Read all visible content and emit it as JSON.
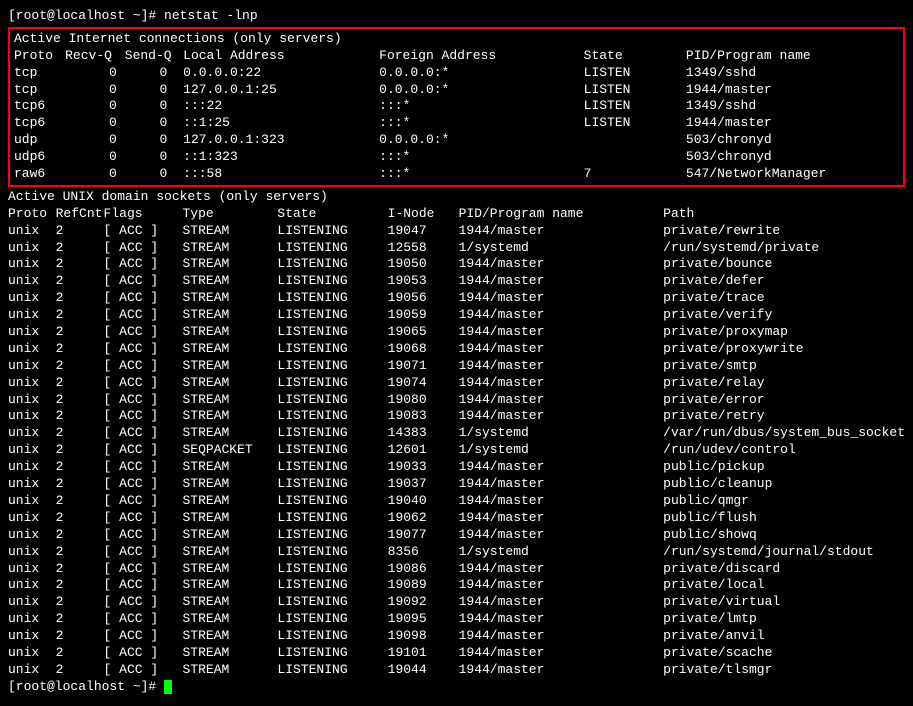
{
  "prompt1": "[root@localhost ~]# netstat -lnp",
  "prompt2": "[root@localhost ~]# ",
  "section1": {
    "title": "Active Internet connections (only servers)",
    "headers": {
      "proto": "Proto",
      "recvq": "Recv-Q",
      "sendq": "Send-Q",
      "local": "Local Address",
      "foreign": "Foreign Address",
      "state": "State",
      "pid": "PID/Program name"
    },
    "rows": [
      {
        "proto": "tcp",
        "recvq": "0",
        "sendq": "0",
        "local": "0.0.0.0:22",
        "foreign": "0.0.0.0:*",
        "state": "LISTEN",
        "pid": "1349/sshd"
      },
      {
        "proto": "tcp",
        "recvq": "0",
        "sendq": "0",
        "local": "127.0.0.1:25",
        "foreign": "0.0.0.0:*",
        "state": "LISTEN",
        "pid": "1944/master"
      },
      {
        "proto": "tcp6",
        "recvq": "0",
        "sendq": "0",
        "local": ":::22",
        "foreign": ":::*",
        "state": "LISTEN",
        "pid": "1349/sshd"
      },
      {
        "proto": "tcp6",
        "recvq": "0",
        "sendq": "0",
        "local": "::1:25",
        "foreign": ":::*",
        "state": "LISTEN",
        "pid": "1944/master"
      },
      {
        "proto": "udp",
        "recvq": "0",
        "sendq": "0",
        "local": "127.0.0.1:323",
        "foreign": "0.0.0.0:*",
        "state": "",
        "pid": "503/chronyd"
      },
      {
        "proto": "udp6",
        "recvq": "0",
        "sendq": "0",
        "local": "::1:323",
        "foreign": ":::*",
        "state": "",
        "pid": "503/chronyd"
      },
      {
        "proto": "raw6",
        "recvq": "0",
        "sendq": "0",
        "local": ":::58",
        "foreign": ":::*",
        "state": "7",
        "pid": "547/NetworkManager"
      }
    ]
  },
  "section2": {
    "title": "Active UNIX domain sockets (only servers)",
    "headers": {
      "proto": "Proto",
      "refcnt": "RefCnt",
      "flags": "Flags",
      "type": "Type",
      "state": "State",
      "inode": "I-Node",
      "pid": "PID/Program name",
      "path": "Path"
    },
    "rows": [
      {
        "proto": "unix",
        "refcnt": "2",
        "flags": "[ ACC ]",
        "type": "STREAM",
        "state": "LISTENING",
        "inode": "19047",
        "pid": "1944/master",
        "path": "private/rewrite"
      },
      {
        "proto": "unix",
        "refcnt": "2",
        "flags": "[ ACC ]",
        "type": "STREAM",
        "state": "LISTENING",
        "inode": "12558",
        "pid": "1/systemd",
        "path": "/run/systemd/private"
      },
      {
        "proto": "unix",
        "refcnt": "2",
        "flags": "[ ACC ]",
        "type": "STREAM",
        "state": "LISTENING",
        "inode": "19050",
        "pid": "1944/master",
        "path": "private/bounce"
      },
      {
        "proto": "unix",
        "refcnt": "2",
        "flags": "[ ACC ]",
        "type": "STREAM",
        "state": "LISTENING",
        "inode": "19053",
        "pid": "1944/master",
        "path": "private/defer"
      },
      {
        "proto": "unix",
        "refcnt": "2",
        "flags": "[ ACC ]",
        "type": "STREAM",
        "state": "LISTENING",
        "inode": "19056",
        "pid": "1944/master",
        "path": "private/trace"
      },
      {
        "proto": "unix",
        "refcnt": "2",
        "flags": "[ ACC ]",
        "type": "STREAM",
        "state": "LISTENING",
        "inode": "19059",
        "pid": "1944/master",
        "path": "private/verify"
      },
      {
        "proto": "unix",
        "refcnt": "2",
        "flags": "[ ACC ]",
        "type": "STREAM",
        "state": "LISTENING",
        "inode": "19065",
        "pid": "1944/master",
        "path": "private/proxymap"
      },
      {
        "proto": "unix",
        "refcnt": "2",
        "flags": "[ ACC ]",
        "type": "STREAM",
        "state": "LISTENING",
        "inode": "19068",
        "pid": "1944/master",
        "path": "private/proxywrite"
      },
      {
        "proto": "unix",
        "refcnt": "2",
        "flags": "[ ACC ]",
        "type": "STREAM",
        "state": "LISTENING",
        "inode": "19071",
        "pid": "1944/master",
        "path": "private/smtp"
      },
      {
        "proto": "unix",
        "refcnt": "2",
        "flags": "[ ACC ]",
        "type": "STREAM",
        "state": "LISTENING",
        "inode": "19074",
        "pid": "1944/master",
        "path": "private/relay"
      },
      {
        "proto": "unix",
        "refcnt": "2",
        "flags": "[ ACC ]",
        "type": "STREAM",
        "state": "LISTENING",
        "inode": "19080",
        "pid": "1944/master",
        "path": "private/error"
      },
      {
        "proto": "unix",
        "refcnt": "2",
        "flags": "[ ACC ]",
        "type": "STREAM",
        "state": "LISTENING",
        "inode": "19083",
        "pid": "1944/master",
        "path": "private/retry"
      },
      {
        "proto": "unix",
        "refcnt": "2",
        "flags": "[ ACC ]",
        "type": "STREAM",
        "state": "LISTENING",
        "inode": "14383",
        "pid": "1/systemd",
        "path": "/var/run/dbus/system_bus_socket"
      },
      {
        "proto": "unix",
        "refcnt": "2",
        "flags": "[ ACC ]",
        "type": "SEQPACKET",
        "state": "LISTENING",
        "inode": "12601",
        "pid": "1/systemd",
        "path": "/run/udev/control"
      },
      {
        "proto": "unix",
        "refcnt": "2",
        "flags": "[ ACC ]",
        "type": "STREAM",
        "state": "LISTENING",
        "inode": "19033",
        "pid": "1944/master",
        "path": "public/pickup"
      },
      {
        "proto": "unix",
        "refcnt": "2",
        "flags": "[ ACC ]",
        "type": "STREAM",
        "state": "LISTENING",
        "inode": "19037",
        "pid": "1944/master",
        "path": "public/cleanup"
      },
      {
        "proto": "unix",
        "refcnt": "2",
        "flags": "[ ACC ]",
        "type": "STREAM",
        "state": "LISTENING",
        "inode": "19040",
        "pid": "1944/master",
        "path": "public/qmgr"
      },
      {
        "proto": "unix",
        "refcnt": "2",
        "flags": "[ ACC ]",
        "type": "STREAM",
        "state": "LISTENING",
        "inode": "19062",
        "pid": "1944/master",
        "path": "public/flush"
      },
      {
        "proto": "unix",
        "refcnt": "2",
        "flags": "[ ACC ]",
        "type": "STREAM",
        "state": "LISTENING",
        "inode": "19077",
        "pid": "1944/master",
        "path": "public/showq"
      },
      {
        "proto": "unix",
        "refcnt": "2",
        "flags": "[ ACC ]",
        "type": "STREAM",
        "state": "LISTENING",
        "inode": "8356",
        "pid": "1/systemd",
        "path": "/run/systemd/journal/stdout"
      },
      {
        "proto": "unix",
        "refcnt": "2",
        "flags": "[ ACC ]",
        "type": "STREAM",
        "state": "LISTENING",
        "inode": "19086",
        "pid": "1944/master",
        "path": "private/discard"
      },
      {
        "proto": "unix",
        "refcnt": "2",
        "flags": "[ ACC ]",
        "type": "STREAM",
        "state": "LISTENING",
        "inode": "19089",
        "pid": "1944/master",
        "path": "private/local"
      },
      {
        "proto": "unix",
        "refcnt": "2",
        "flags": "[ ACC ]",
        "type": "STREAM",
        "state": "LISTENING",
        "inode": "19092",
        "pid": "1944/master",
        "path": "private/virtual"
      },
      {
        "proto": "unix",
        "refcnt": "2",
        "flags": "[ ACC ]",
        "type": "STREAM",
        "state": "LISTENING",
        "inode": "19095",
        "pid": "1944/master",
        "path": "private/lmtp"
      },
      {
        "proto": "unix",
        "refcnt": "2",
        "flags": "[ ACC ]",
        "type": "STREAM",
        "state": "LISTENING",
        "inode": "19098",
        "pid": "1944/master",
        "path": "private/anvil"
      },
      {
        "proto": "unix",
        "refcnt": "2",
        "flags": "[ ACC ]",
        "type": "STREAM",
        "state": "LISTENING",
        "inode": "19101",
        "pid": "1944/master",
        "path": "private/scache"
      },
      {
        "proto": "unix",
        "refcnt": "2",
        "flags": "[ ACC ]",
        "type": "STREAM",
        "state": "LISTENING",
        "inode": "19044",
        "pid": "1944/master",
        "path": "private/tlsmgr"
      }
    ]
  }
}
